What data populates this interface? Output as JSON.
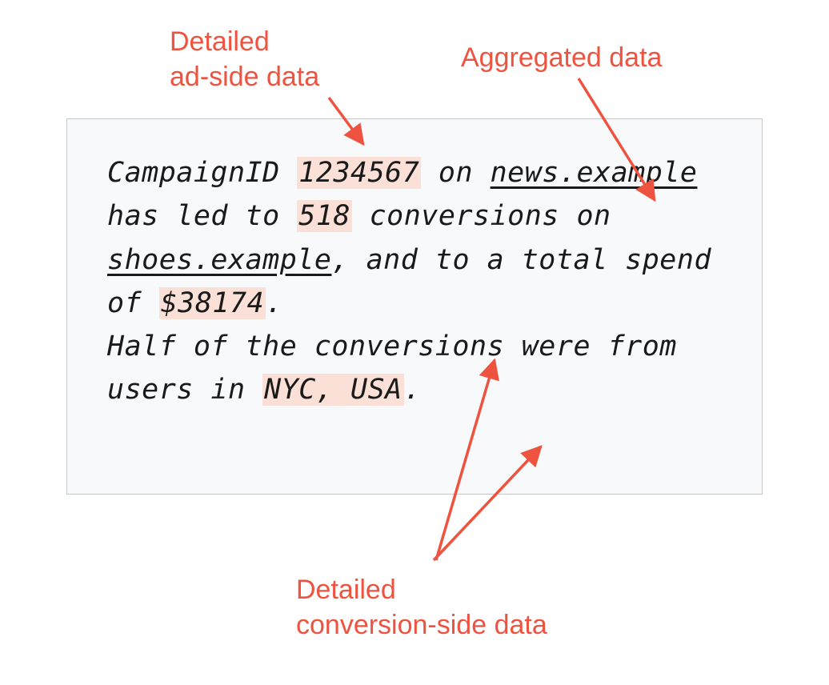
{
  "labels": {
    "top_left_l1": "Detailed",
    "top_left_l2": "ad-side data",
    "top_right": "Aggregated data",
    "bottom_l1": "Detailed",
    "bottom_l2": "conversion-side data"
  },
  "body": {
    "t1": "CampaignID ",
    "campaign_id": "1234567",
    "t2": " on ",
    "site1": "news.example",
    "t3": " has led to ",
    "count": "518",
    "t4": " conversions on ",
    "site2": "shoes.example",
    "t5": ", and to a total spend of ",
    "spend": "$38174",
    "t6": ".",
    "t7": "Half of the conversions were from users in ",
    "loc": "NYC, USA",
    "t8": "."
  },
  "colors": {
    "accent": "#ee5340",
    "highlight": "#fbe0d7",
    "box_bg": "#f8f9fa"
  }
}
